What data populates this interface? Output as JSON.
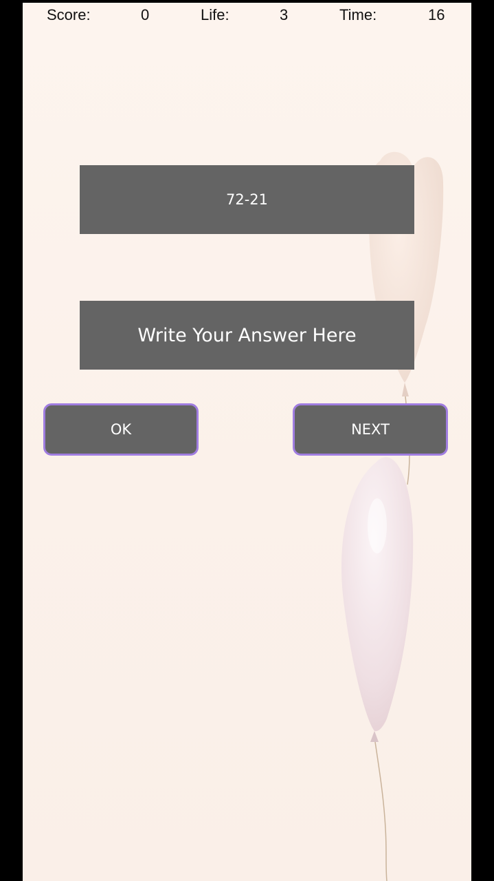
{
  "status": {
    "score_label": "Score:",
    "score_value": "0",
    "life_label": "Life:",
    "life_value": "3",
    "time_label": "Time:",
    "time_value": "16"
  },
  "question": {
    "text": "72-21"
  },
  "answer": {
    "placeholder": "Write Your Answer Here",
    "value": ""
  },
  "buttons": {
    "ok_label": "OK",
    "next_label": "NEXT"
  },
  "background": {
    "image": "balloons-icon",
    "color": "#fdf4ee"
  },
  "colors": {
    "panel": "#646464",
    "button_border": "#a07de0",
    "text_light": "#ffffff",
    "text_dark": "#111111"
  }
}
